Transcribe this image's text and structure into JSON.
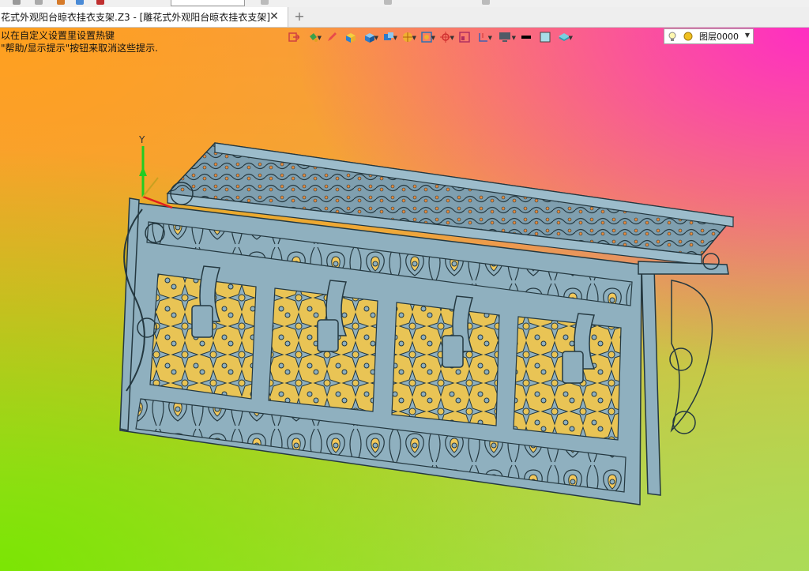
{
  "tabs": {
    "active_title": "花式外观阳台晾衣挂衣支架.Z3 - [雕花式外观阳台晾衣挂衣支架]",
    "close_glyph": "✕",
    "add_glyph": "+"
  },
  "hints": {
    "line1": "以在自定义设置里设置热键",
    "line2": "\"帮助/显示提示\"按钮来取消这些提示."
  },
  "toolbar": {
    "icons": [
      "exit-icon",
      "paint-bucket-icon",
      "pencil-icon",
      "box-shaded-icon",
      "cube-icon",
      "view-orient-icon",
      "render-mode-icon",
      "zoom-fit-icon",
      "axis-icon",
      "frame-icon",
      "section-icon",
      "display-icon",
      "line-color-swatch",
      "face-color-swatch",
      "layer-stack-icon"
    ],
    "layer": {
      "label": "图层0000",
      "icons": [
        "lightbulb-icon",
        "layer-circle-icon"
      ]
    }
  },
  "triad": {
    "y_label": "Y"
  },
  "colors": {
    "model_fill": "#8fb0bf",
    "model_stroke": "#243840",
    "axis_y": "#22cc22",
    "axis_x": "#e02020"
  }
}
